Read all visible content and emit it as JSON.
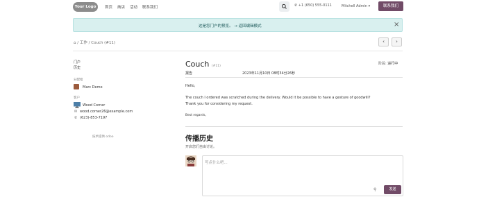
{
  "header": {
    "logo_text": "Your Logo",
    "nav": [
      "首页",
      "商店",
      "活动",
      "联系我们"
    ],
    "phone": "+1 (650) 555-0111",
    "user": "Mitchell Admin",
    "contact_label": "联系我们"
  },
  "banner": {
    "text": "这是您门户的预览。 → 返回编辑模式"
  },
  "breadcrumb": {
    "sep": "/",
    "tasks": "工作",
    "current": "Couch (#11)"
  },
  "sidebar": {
    "links": [
      "门户",
      "历史"
    ],
    "assignee_heading": "分配给",
    "assignee_name": "Marc Demo",
    "customer_heading": "客户",
    "customer_name": "Wood Corner",
    "email": "wood.corner26@example.com",
    "phone": "(623)-853-7197",
    "powered": "技术提供 odoo"
  },
  "task": {
    "title": "Couch",
    "id": "(#11)",
    "stage_label": "阶段:",
    "stage_value": "进行中",
    "report_label": "报告",
    "report_date": "2023年11月10日 08时34分26秒",
    "greeting": "Hello,",
    "body1": "The couch I ordered was scratched during the delivery. Would it be possible to have a gesture of goodwill?",
    "body2": "Thank you for considering my request.",
    "regards": "Best regards,"
  },
  "chatter": {
    "title": "传播历史",
    "subtitle": "开启您们自由讨论。",
    "placeholder": "写点什么吧...",
    "send_label": "发送"
  },
  "colors": {
    "brand": "#714b67",
    "banner_bg": "#d9f0ef",
    "banner_text": "#1f5a5b"
  }
}
